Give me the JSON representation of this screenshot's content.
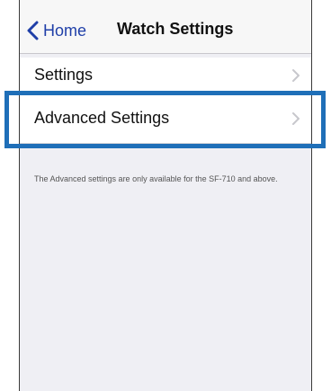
{
  "nav": {
    "back_label": "Home",
    "title": "Watch Settings"
  },
  "rows": [
    {
      "label": "Settings"
    },
    {
      "label": "Advanced Settings"
    }
  ],
  "note": "The Advanced settings are only available for the SF-710 and above.",
  "colors": {
    "accent": "#1f3fa8",
    "highlight": "#1f6fb8",
    "background": "#efeff4"
  },
  "icons": [
    "chevron-left-icon",
    "chevron-right-icon"
  ]
}
